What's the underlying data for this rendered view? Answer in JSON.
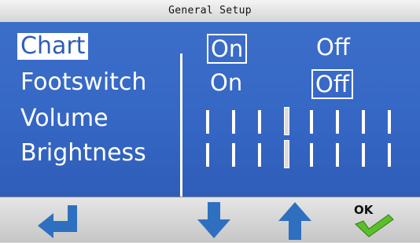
{
  "title": "General Setup",
  "rows": [
    {
      "label": "Chart",
      "selected": true,
      "options": [
        "On",
        "Off"
      ],
      "value": "On"
    },
    {
      "label": "Footswitch",
      "selected": false,
      "options": [
        "On",
        "Off"
      ],
      "value": "Off"
    },
    {
      "label": "Volume",
      "selected": false,
      "level_steps": 8,
      "level": 4
    },
    {
      "label": "Brightness",
      "selected": false,
      "level_steps": 8,
      "level": 4
    }
  ],
  "buttons": {
    "back_icon": "return-arrow-icon",
    "down_icon": "arrow-down-icon",
    "up_icon": "arrow-up-icon",
    "ok_label": "OK",
    "ok_icon": "ok-checkmark-icon"
  },
  "colors": {
    "panel_blue": "#3566c4",
    "icon_blue": "#2f6fbf",
    "check_green": "#5bbf2a"
  }
}
